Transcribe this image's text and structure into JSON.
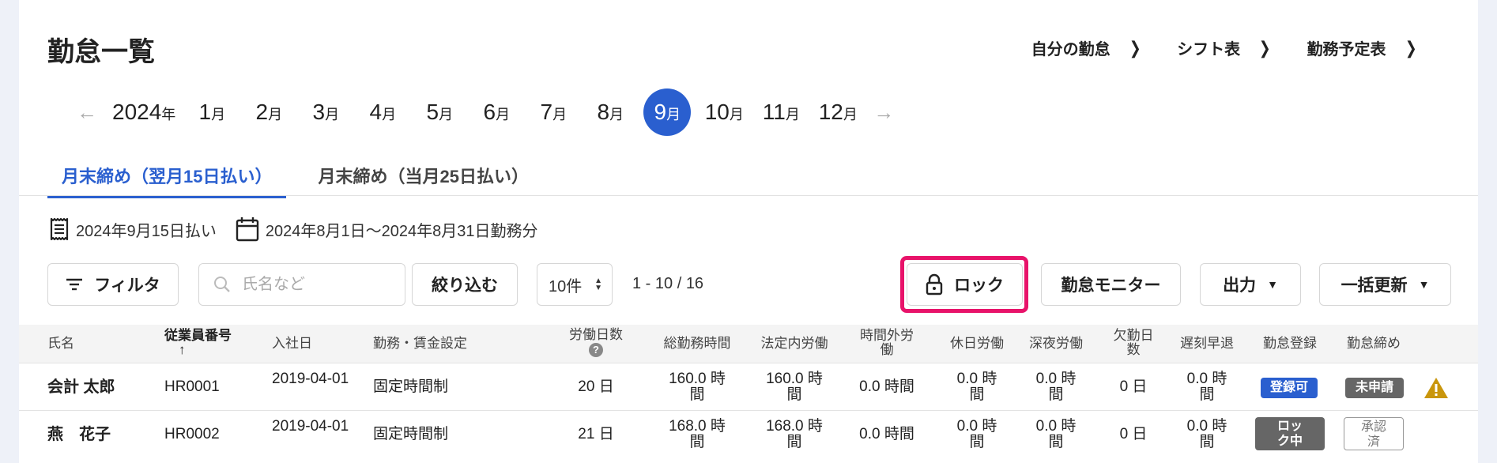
{
  "page_title": "勤怠一覧",
  "top_links": [
    "自分の勤怠",
    "シフト表",
    "勤務予定表"
  ],
  "month_nav": {
    "year": "2024",
    "year_suffix": "年",
    "month_suffix": "月",
    "months": [
      "1",
      "2",
      "3",
      "4",
      "5",
      "6",
      "7",
      "8",
      "9",
      "10",
      "11",
      "12"
    ],
    "selected_month": "9"
  },
  "tabs": [
    "月末締め（翌月15日払い）",
    "月末締め（当月25日払い）"
  ],
  "info": {
    "pay_date": "2024年9月15日払い",
    "work_period": "2024年8月1日〜2024年8月31日勤務分"
  },
  "toolbar": {
    "filter_label": "フィルタ",
    "search_placeholder": "氏名など",
    "narrow_label": "絞り込む",
    "per_page": "10件",
    "page_info": "1 - 10 / 16",
    "lock_label": "ロック",
    "monitor_label": "勤怠モニター",
    "output_label": "出力",
    "bulk_update_label": "一括更新"
  },
  "table": {
    "headers": {
      "name": "氏名",
      "employee_no": "従業員番号",
      "hire_date": "入社日",
      "wage_setting": "勤務・賃金設定",
      "work_days": "労働日数",
      "total_hours": "総勤務時間",
      "legal_hours": "法定内労働",
      "overtime": "時間外労働",
      "holiday": "休日労働",
      "night": "深夜労働",
      "absent_days": "欠勤日数",
      "late_early": "遅刻早退",
      "registration": "勤怠登録",
      "closing": "勤怠締め"
    },
    "rows": [
      {
        "name": "会計 太郎",
        "employee_no": "HR0001",
        "hire_date": "2019-04-01",
        "wage_setting": "固定時間制",
        "work_days": "20 日",
        "total_hours": "160.0 時間",
        "legal_hours": "160.0 時間",
        "overtime": "0.0 時間",
        "holiday": "0.0 時間",
        "night": "0.0 時間",
        "absent_days": "0 日",
        "late_early": "0.0 時間",
        "registration": "登録可",
        "closing": "未申請"
      },
      {
        "name": "燕　花子",
        "employee_no": "HR0002",
        "hire_date": "2019-04-01",
        "wage_setting": "固定時間制",
        "work_days": "21 日",
        "total_hours": "168.0 時間",
        "legal_hours": "168.0 時間",
        "overtime": "0.0 時間",
        "holiday": "0.0 時間",
        "night": "0.0 時間",
        "absent_days": "0 日",
        "late_early": "0.0 時間",
        "registration": "ロック中",
        "closing": "承認済"
      }
    ]
  },
  "colors": {
    "accent": "#2a5fcf",
    "highlight": "#e8136a",
    "warning": "#c9960c"
  }
}
